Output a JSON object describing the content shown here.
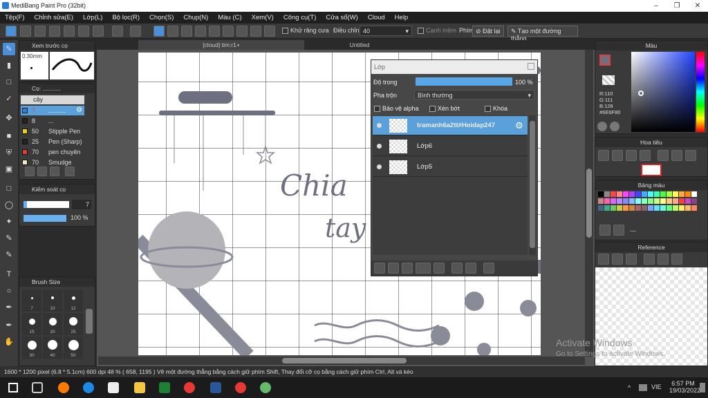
{
  "window": {
    "title": "MediBang Paint Pro (32bit)"
  },
  "menu": [
    "Tệp(F)",
    "Chỉnh sửa(E)",
    "Lớp(L)",
    "Bộ lọc(R)",
    "Chọn(S)",
    "Chụp(N)",
    "Màu (C)",
    "Xem(V)",
    "Công cụ(T)",
    "Cửa sổ(W)",
    "Cloud",
    "Help"
  ],
  "toolbar": {
    "antialias_label": "Khử răng cưa",
    "adjust_label": "Điều chỉnh",
    "adjust_value": "40",
    "smooth_label": "Cạnh mềm",
    "key_label": "Phím",
    "reset_label": "Đặt lại",
    "line_label": "Tạo một đường thẳng"
  },
  "brush_preview": {
    "title": "Xem trước cọ",
    "size": "0.30mm"
  },
  "brush_panel": {
    "title": "Cọ: ...........",
    "group": "cây",
    "items": [
      {
        "size": "7",
        "name": "..........",
        "color": "#1e88e5",
        "selected": true
      },
      {
        "size": "8",
        "name": "...",
        "color": "#222222",
        "selected": false
      },
      {
        "size": "50",
        "name": "Stipple Pen",
        "color": "#f4d000",
        "selected": false
      },
      {
        "size": "25",
        "name": "Pen (Sharp)",
        "color": "#222222",
        "selected": false
      },
      {
        "size": "70",
        "name": "pen chuyên",
        "color": "#e53935",
        "selected": false
      },
      {
        "size": "70",
        "name": "Smudge",
        "color": "#f5e6c8",
        "selected": false
      }
    ]
  },
  "brush_control": {
    "title": "Kiểm soát cọ",
    "size_value": "7",
    "opacity_value": "100 %",
    "opacity_fraction": 1.0
  },
  "brush_size": {
    "title": "Brush Size",
    "labels": [
      "7",
      "10",
      "12",
      "15",
      "20",
      "25",
      "30",
      "40",
      "50"
    ]
  },
  "tabs": [
    {
      "label": "[cloud] tim:r1+"
    },
    {
      "label": "Untitled"
    }
  ],
  "canvas_text": {
    "line1": "Chia",
    "line2": "tay"
  },
  "layer_panel": {
    "title": "Lớp",
    "opacity_label": "Độ trong",
    "opacity_value": "100 %",
    "opacity_fraction": 1.0,
    "blend_label": "Pha trộn",
    "blend_value": "Bình thường",
    "protect_alpha": "Bảo vệ alpha",
    "clipping": "Xén bớt",
    "lock": "Khóa",
    "layers": [
      {
        "name": "tramanh6a2tt#Hoidap247",
        "selected": true
      },
      {
        "name": "Lớp6",
        "selected": false
      },
      {
        "name": "Lớp5",
        "selected": false
      }
    ]
  },
  "color_panel": {
    "title": "Màu",
    "r": "R:110",
    "g": "G:111",
    "b": "B:128",
    "hex": "#6E6F80",
    "current_color": "#6E6F80",
    "fg_color": "#8b1a3a"
  },
  "navigator": {
    "title": "Hoa tiêu"
  },
  "palette": {
    "title": "Bảng màu",
    "label": "---"
  },
  "reference": {
    "title": "Reference"
  },
  "watermark": {
    "line1": "Activate Windows",
    "line2": "Go to Settings to activate Windows."
  },
  "status": {
    "text": "1600 * 1200 pixel  (6.8 * 5.1cm)  600 dpi  48 %  ( 658, 1195 )  Vẽ một đường thẳng bằng cách giữ phím Shift, Thay đổi cỡ cọ bằng cách giữ phím Ctrl, Alt và kéo"
  },
  "taskbar": {
    "lang": "VIE",
    "time": "6:57 PM",
    "date": "19/03/2022"
  }
}
